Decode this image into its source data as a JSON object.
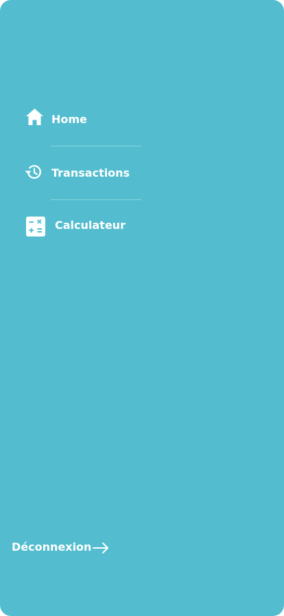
{
  "theme": {
    "background": "#53BDCF",
    "foreground": "#FFFFFF",
    "divider": "#8AD3E0",
    "icon_accent": "#53BDCF"
  },
  "menu": {
    "items": [
      {
        "label": "Home",
        "icon": "home-icon"
      },
      {
        "label": "Transactions",
        "icon": "history-icon"
      },
      {
        "label": "Calculateur",
        "icon": "calculator-icon"
      }
    ]
  },
  "logout": {
    "label": "Déconnexion",
    "icon": "arrow-right-icon"
  }
}
